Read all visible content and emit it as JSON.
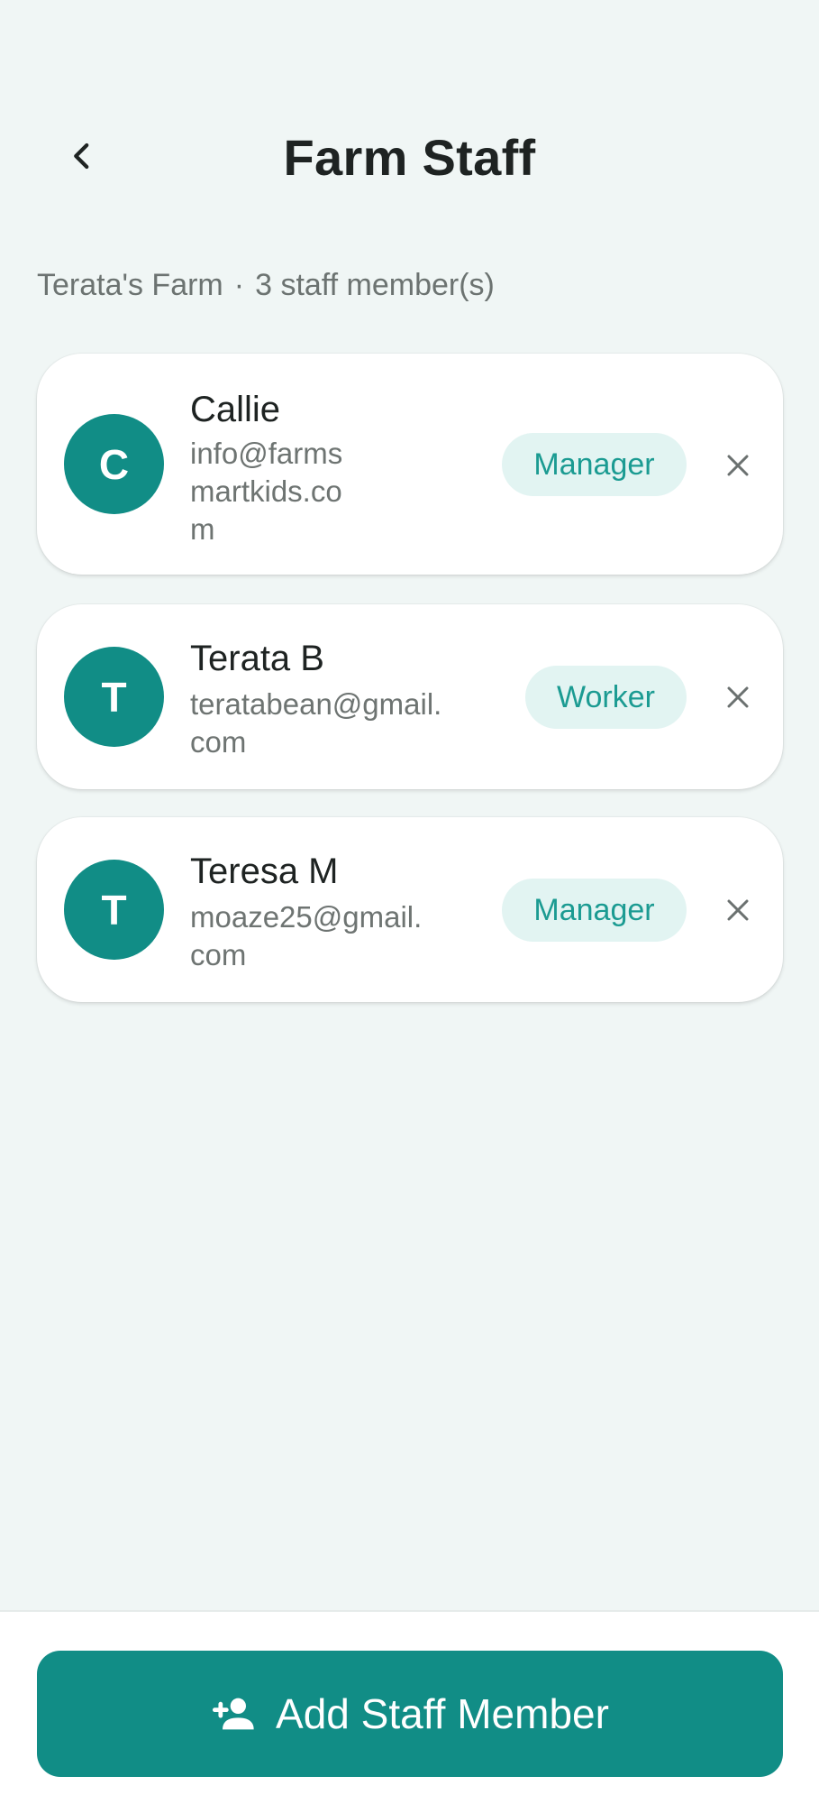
{
  "header": {
    "title": "Farm Staff",
    "back_icon": "chevron-left-icon"
  },
  "summary": {
    "farm_name": "Terata's Farm",
    "separator": "·",
    "count_text": "3 staff member(s)"
  },
  "staff": [
    {
      "initial": "C",
      "name": "Callie",
      "email": "info@farmsmartkids.com",
      "role": "Manager"
    },
    {
      "initial": "T",
      "name": "Terata B",
      "email": "teratabean@gmail.com",
      "role": "Worker"
    },
    {
      "initial": "T",
      "name": "Teresa M",
      "email": "moaze25@gmail.com",
      "role": "Manager"
    }
  ],
  "actions": {
    "add_staff_label": "Add Staff Member",
    "add_staff_icon": "person-add-icon",
    "remove_icon": "close-icon"
  },
  "colors": {
    "background": "#f0f6f5",
    "accent": "#118d86",
    "badge_bg": "#e2f4f2",
    "badge_text": "#1b9b92"
  }
}
